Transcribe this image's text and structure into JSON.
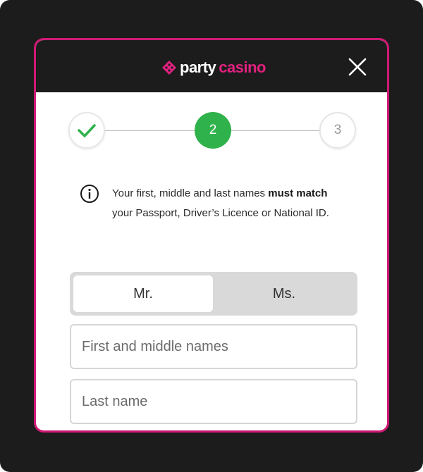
{
  "header": {
    "logo": {
      "part1": "party",
      "part2": "casino",
      "icon": "diamond-dots-logo-icon"
    },
    "close": {
      "icon": "close-icon"
    }
  },
  "colors": {
    "accent": "#d01975",
    "brand_pink": "#e0217f",
    "step_active": "#2fb24b",
    "header_bg": "#1c1c1c"
  },
  "stepper": {
    "steps": [
      {
        "label": "",
        "state": "done",
        "icon": "check-icon"
      },
      {
        "label": "2",
        "state": "active"
      },
      {
        "label": "3",
        "state": "todo"
      }
    ]
  },
  "info": {
    "icon": "info-icon",
    "text_before": "Your first, middle and last names ",
    "text_bold": "must match",
    "text_after": " your Passport, Driver’s Licence or National ID."
  },
  "gender": {
    "options": [
      {
        "label": "Mr."
      },
      {
        "label": "Ms."
      }
    ],
    "selected": "Mr."
  },
  "form": {
    "first_name": {
      "value": "",
      "placeholder": "First and middle names"
    },
    "last_name": {
      "value": "",
      "placeholder": "Last name"
    }
  }
}
